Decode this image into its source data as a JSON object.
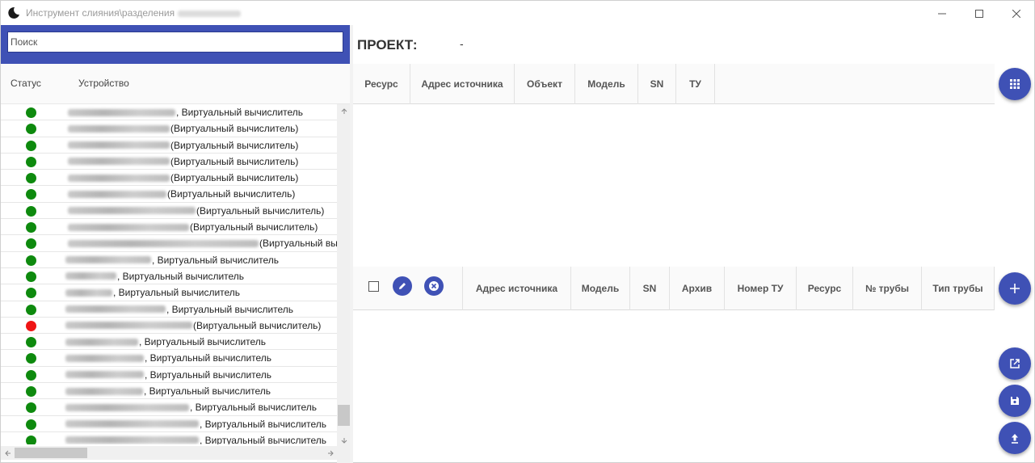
{
  "window": {
    "title": "Инструмент слияния\\разделения"
  },
  "sidebar": {
    "search_placeholder": "Поиск",
    "columns": {
      "status": "Статус",
      "device": "Устройство"
    },
    "items": [
      {
        "status": "green",
        "label": ", Виртуальный вычислитель"
      },
      {
        "status": "green",
        "label": "(Виртуальный вычислитель)"
      },
      {
        "status": "green",
        "label": "(Виртуальный вычислитель)"
      },
      {
        "status": "green",
        "label": "(Виртуальный вычислитель)"
      },
      {
        "status": "green",
        "label": "(Виртуальный вычислитель)"
      },
      {
        "status": "green",
        "label": "(Виртуальный вычислитель)"
      },
      {
        "status": "green",
        "label": "(Виртуальный вычислитель)"
      },
      {
        "status": "green",
        "label": "(Виртуальный вычислитель)"
      },
      {
        "status": "green",
        "label": "(Виртуальный вы"
      },
      {
        "status": "green",
        "label": ", Виртуальный вычислитель"
      },
      {
        "status": "green",
        "label": ", Виртуальный вычислитель"
      },
      {
        "status": "green",
        "label": ", Виртуальный вычислитель"
      },
      {
        "status": "green",
        "label": ", Виртуальный вычислитель"
      },
      {
        "status": "red",
        "label": "(Виртуальный вычислитель)"
      },
      {
        "status": "green",
        "label": ", Виртуальный вычислитель"
      },
      {
        "status": "green",
        "label": ", Виртуальный вычислитель"
      },
      {
        "status": "green",
        "label": ", Виртуальный вычислитель"
      },
      {
        "status": "green",
        "label": ", Виртуальный вычислитель"
      },
      {
        "status": "green",
        "label": ", Виртуальный вычислитель"
      },
      {
        "status": "green",
        "label": ", Виртуальный вычислитель"
      },
      {
        "status": "green",
        "label": ", Виртуальный вычислитель"
      }
    ]
  },
  "project": {
    "label": "ПРОЕКТ:",
    "value": "-"
  },
  "top_grid": {
    "columns": [
      "Ресурс",
      "Адрес источника",
      "Объект",
      "Модель",
      "SN",
      "ТУ"
    ]
  },
  "bottom_grid": {
    "columns": [
      "Адрес источника",
      "Модель",
      "SN",
      "Архив",
      "Номер ТУ",
      "Ресурс",
      "№ трубы",
      "Тип трубы"
    ]
  },
  "colors": {
    "accent": "#3f51b5",
    "status_ok": "#0e8a0e",
    "status_error": "#ef1414"
  },
  "icons": {
    "grid_button": "apps-grid-icon",
    "add_button": "plus-icon",
    "open_button": "open-in-new-icon",
    "save_button": "save-icon",
    "upload_button": "upload-icon"
  }
}
